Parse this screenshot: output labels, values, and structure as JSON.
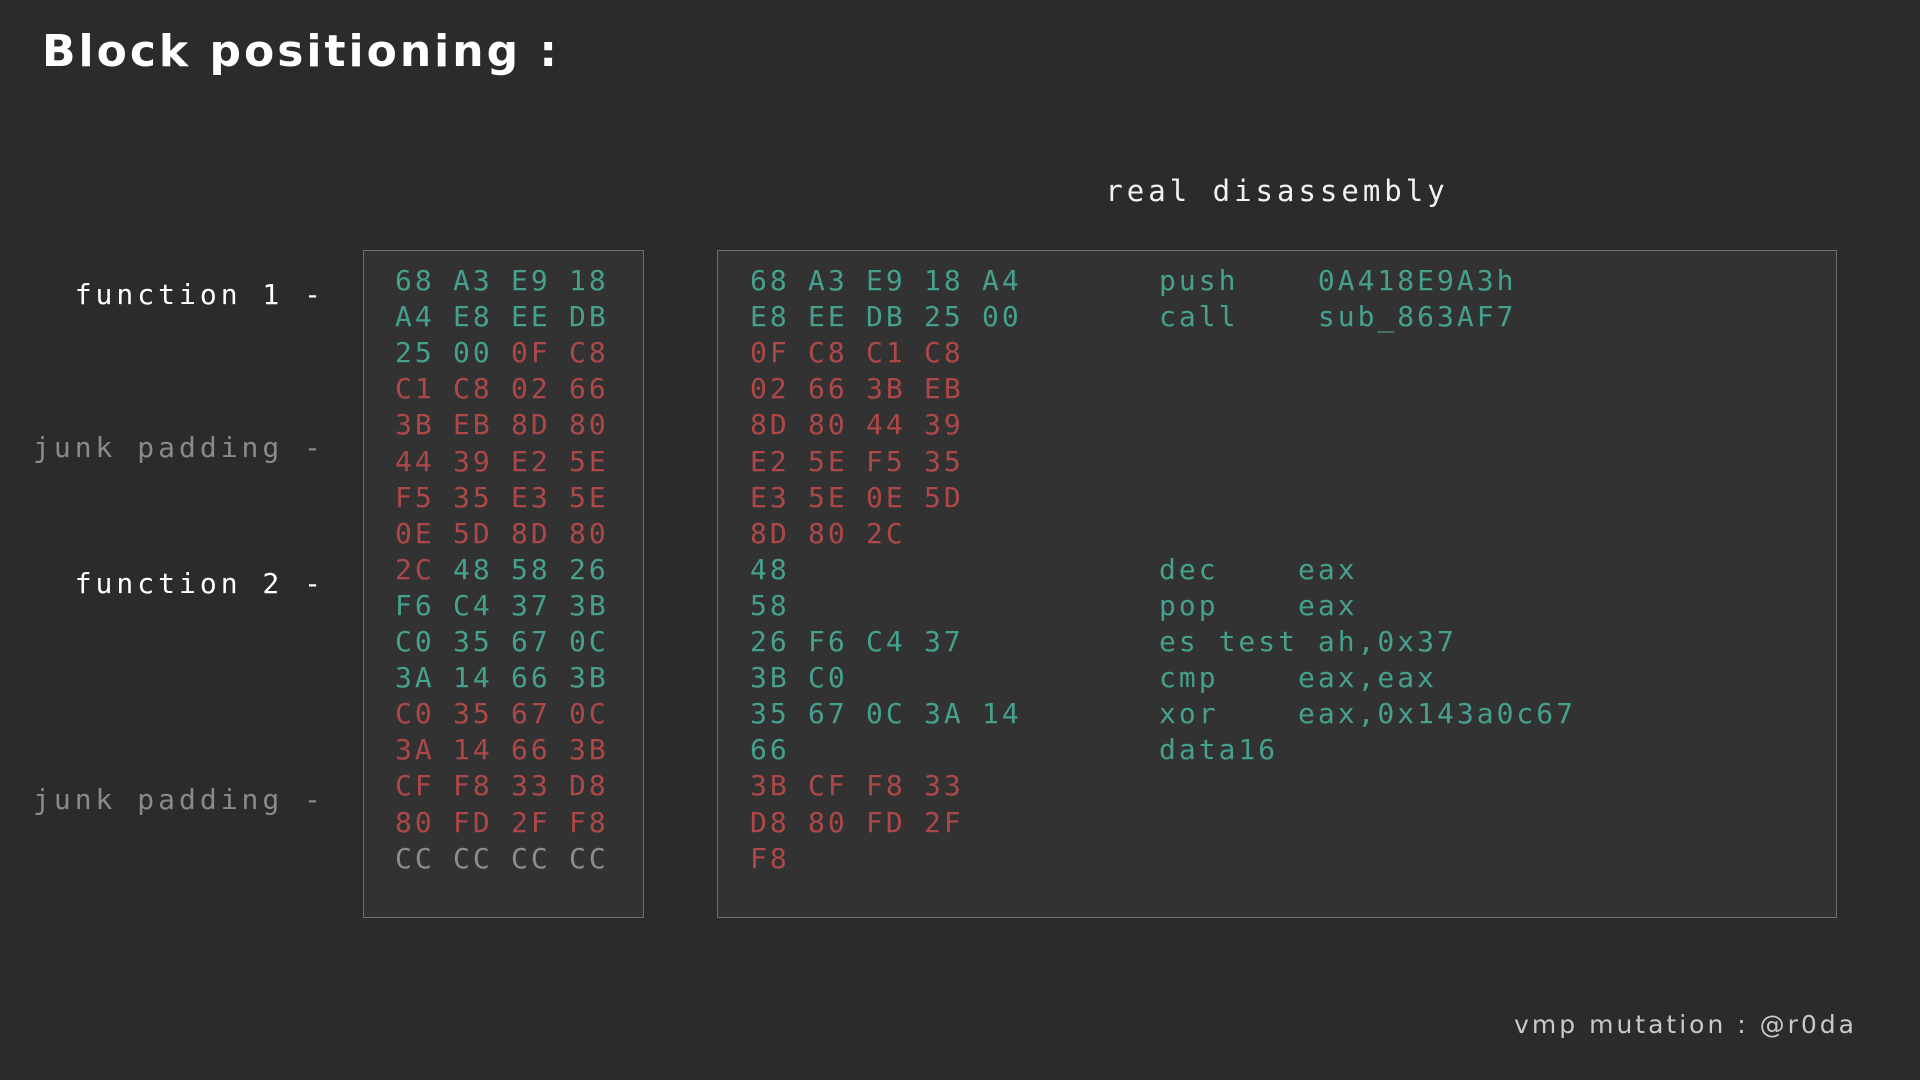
{
  "title": "Block positioning :",
  "disasm_heading": "real disassembly",
  "labels": [
    {
      "text": "function 1 -",
      "kind": "function"
    },
    {
      "text": "junk padding -",
      "kind": "junk"
    },
    {
      "text": "function 2 -",
      "kind": "function"
    },
    {
      "text": "junk padding -",
      "kind": "junk"
    }
  ],
  "colors": {
    "background": "#2b2b2b",
    "panel": "#323232",
    "real_code": "#45a08e",
    "junk_code": "#ae4848",
    "padding_bytes": "#8c8c8c",
    "function_label": "#ffffff",
    "junk_label": "#8a8a8a"
  },
  "byte_rows": [
    [
      {
        "v": "68",
        "k": "real"
      },
      {
        "v": "A3",
        "k": "real"
      },
      {
        "v": "E9",
        "k": "real"
      },
      {
        "v": "18",
        "k": "real"
      }
    ],
    [
      {
        "v": "A4",
        "k": "real"
      },
      {
        "v": "E8",
        "k": "real"
      },
      {
        "v": "EE",
        "k": "real"
      },
      {
        "v": "DB",
        "k": "real"
      }
    ],
    [
      {
        "v": "25",
        "k": "real"
      },
      {
        "v": "00",
        "k": "real"
      },
      {
        "v": "0F",
        "k": "junk"
      },
      {
        "v": "C8",
        "k": "junk"
      }
    ],
    [
      {
        "v": "C1",
        "k": "junk"
      },
      {
        "v": "C8",
        "k": "junk"
      },
      {
        "v": "02",
        "k": "junk"
      },
      {
        "v": "66",
        "k": "junk"
      }
    ],
    [
      {
        "v": "3B",
        "k": "junk"
      },
      {
        "v": "EB",
        "k": "junk"
      },
      {
        "v": "8D",
        "k": "junk"
      },
      {
        "v": "80",
        "k": "junk"
      }
    ],
    [
      {
        "v": "44",
        "k": "junk"
      },
      {
        "v": "39",
        "k": "junk"
      },
      {
        "v": "E2",
        "k": "junk"
      },
      {
        "v": "5E",
        "k": "junk"
      }
    ],
    [
      {
        "v": "F5",
        "k": "junk"
      },
      {
        "v": "35",
        "k": "junk"
      },
      {
        "v": "E3",
        "k": "junk"
      },
      {
        "v": "5E",
        "k": "junk"
      }
    ],
    [
      {
        "v": "0E",
        "k": "junk"
      },
      {
        "v": "5D",
        "k": "junk"
      },
      {
        "v": "8D",
        "k": "junk"
      },
      {
        "v": "80",
        "k": "junk"
      }
    ],
    [
      {
        "v": "2C",
        "k": "junk"
      },
      {
        "v": "48",
        "k": "real"
      },
      {
        "v": "58",
        "k": "real"
      },
      {
        "v": "26",
        "k": "real"
      }
    ],
    [
      {
        "v": "F6",
        "k": "real"
      },
      {
        "v": "C4",
        "k": "real"
      },
      {
        "v": "37",
        "k": "real"
      },
      {
        "v": "3B",
        "k": "real"
      }
    ],
    [
      {
        "v": "C0",
        "k": "real"
      },
      {
        "v": "35",
        "k": "real"
      },
      {
        "v": "67",
        "k": "real"
      },
      {
        "v": "0C",
        "k": "real"
      }
    ],
    [
      {
        "v": "3A",
        "k": "real"
      },
      {
        "v": "14",
        "k": "real"
      },
      {
        "v": "66",
        "k": "real"
      },
      {
        "v": "3B",
        "k": "real"
      }
    ],
    [
      {
        "v": "C0",
        "k": "junk"
      },
      {
        "v": "35",
        "k": "junk"
      },
      {
        "v": "67",
        "k": "junk"
      },
      {
        "v": "0C",
        "k": "junk"
      }
    ],
    [
      {
        "v": "3A",
        "k": "junk"
      },
      {
        "v": "14",
        "k": "junk"
      },
      {
        "v": "66",
        "k": "junk"
      },
      {
        "v": "3B",
        "k": "junk"
      }
    ],
    [
      {
        "v": "CF",
        "k": "junk"
      },
      {
        "v": "F8",
        "k": "junk"
      },
      {
        "v": "33",
        "k": "junk"
      },
      {
        "v": "D8",
        "k": "junk"
      }
    ],
    [
      {
        "v": "80",
        "k": "junk"
      },
      {
        "v": "FD",
        "k": "junk"
      },
      {
        "v": "2F",
        "k": "junk"
      },
      {
        "v": "F8",
        "k": "junk"
      }
    ],
    [
      {
        "v": "CC",
        "k": "pad"
      },
      {
        "v": "CC",
        "k": "pad"
      },
      {
        "v": "CC",
        "k": "pad"
      },
      {
        "v": "CC",
        "k": "pad"
      }
    ]
  ],
  "disasm_rows": [
    {
      "bytes": [
        "68",
        "A3",
        "E9",
        "18",
        "A4"
      ],
      "asm": "push    0A418E9A3h",
      "k": "real"
    },
    {
      "bytes": [
        "E8",
        "EE",
        "DB",
        "25",
        "00"
      ],
      "asm": "call    sub_863AF7",
      "k": "real"
    },
    {
      "bytes": [
        "0F",
        "C8",
        "C1",
        "C8"
      ],
      "asm": "",
      "k": "junk"
    },
    {
      "bytes": [
        "02",
        "66",
        "3B",
        "EB"
      ],
      "asm": "",
      "k": "junk"
    },
    {
      "bytes": [
        "8D",
        "80",
        "44",
        "39"
      ],
      "asm": "",
      "k": "junk"
    },
    {
      "bytes": [
        "E2",
        "5E",
        "F5",
        "35"
      ],
      "asm": "",
      "k": "junk"
    },
    {
      "bytes": [
        "E3",
        "5E",
        "0E",
        "5D"
      ],
      "asm": "",
      "k": "junk"
    },
    {
      "bytes": [
        "8D",
        "80",
        "2C"
      ],
      "asm": "",
      "k": "junk"
    },
    {
      "bytes": [
        "48"
      ],
      "asm": "dec    eax",
      "k": "real"
    },
    {
      "bytes": [
        "58"
      ],
      "asm": "pop    eax",
      "k": "real"
    },
    {
      "bytes": [
        "26",
        "F6",
        "C4",
        "37"
      ],
      "asm": "es test ah,0x37",
      "k": "real"
    },
    {
      "bytes": [
        "3B",
        "C0"
      ],
      "asm": "cmp    eax,eax",
      "k": "real"
    },
    {
      "bytes": [
        "35",
        "67",
        "0C",
        "3A",
        "14"
      ],
      "asm": "xor    eax,0x143a0c67",
      "k": "real"
    },
    {
      "bytes": [
        "66"
      ],
      "asm": "data16",
      "k": "real"
    },
    {
      "bytes": [
        "3B",
        "CF",
        "F8",
        "33"
      ],
      "asm": "",
      "k": "junk"
    },
    {
      "bytes": [
        "D8",
        "80",
        "FD",
        "2F"
      ],
      "asm": "",
      "k": "junk"
    },
    {
      "bytes": [
        "F8"
      ],
      "asm": "",
      "k": "junk"
    }
  ],
  "footer": "vmp mutation : @r0da"
}
